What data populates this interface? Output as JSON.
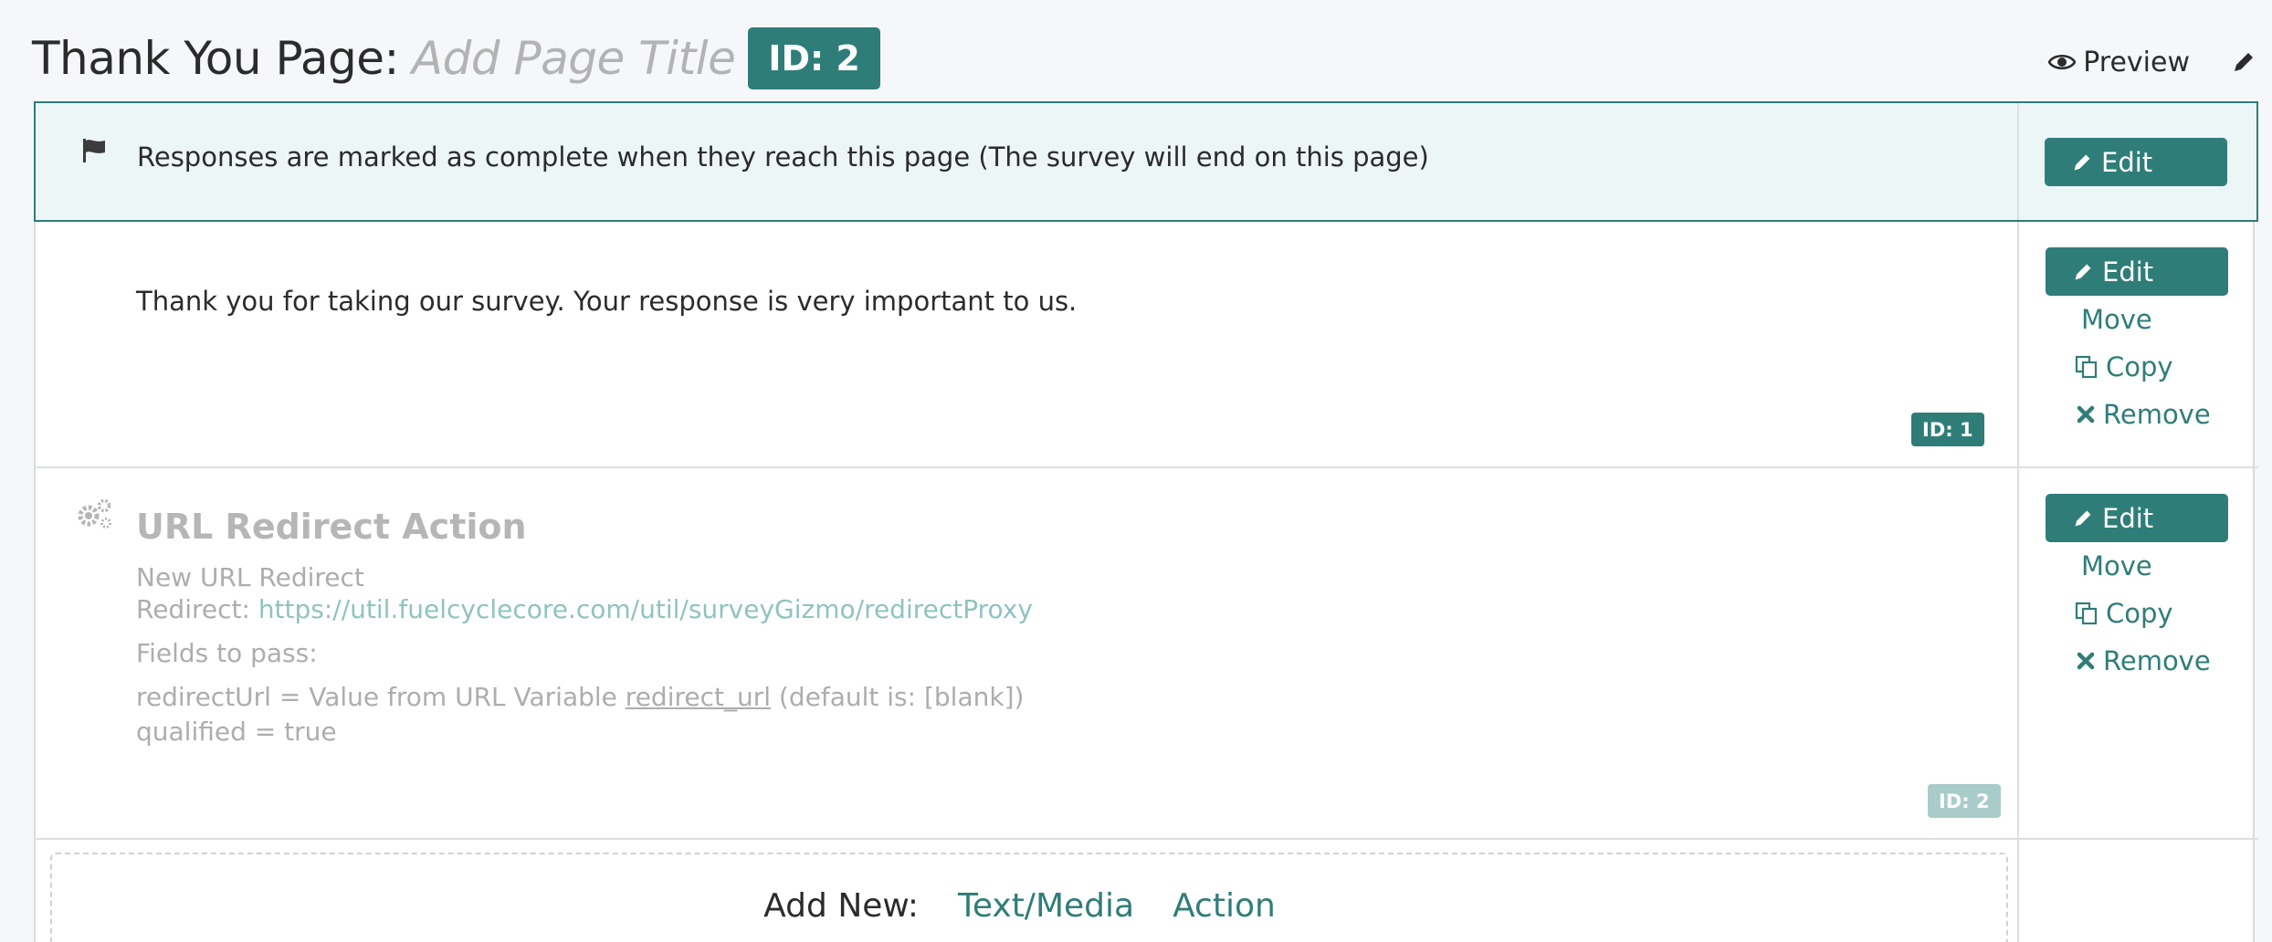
{
  "header": {
    "title_label": "Thank You Page:",
    "title_placeholder": "Add Page Title",
    "page_id": "ID: 2",
    "preview_label": "Preview"
  },
  "completion": {
    "message": "Responses are marked as complete when they reach this page (The survey will end on this page)",
    "edit_label": "Edit"
  },
  "text_item": {
    "text": "Thank you for taking our survey. Your response is very important to us.",
    "id_label": "ID: 1",
    "edit_label": "Edit",
    "move_label": "Move",
    "copy_label": "Copy",
    "remove_label": "Remove"
  },
  "action_item": {
    "title": "URL Redirect Action",
    "name": "New URL Redirect",
    "redirect_label": "Redirect:",
    "redirect_url": "https://util.fuelcyclecore.com/util/surveyGizmo/redirectProxy",
    "fields_label": "Fields to pass:",
    "field1_prefix": "redirectUrl = Value from URL Variable",
    "field1_var": "redirect_url",
    "field1_suffix": "(default is: [blank])",
    "field2": "qualified = true",
    "id_label": "ID: 2",
    "edit_label": "Edit",
    "move_label": "Move",
    "copy_label": "Copy",
    "remove_label": "Remove"
  },
  "add_new": {
    "label": "Add New:",
    "text_media": "Text/Media",
    "action": "Action"
  },
  "colors": {
    "accent": "#2f7d79",
    "completion_bg": "#edf6f7",
    "muted_badge": "#a9cbc9"
  }
}
